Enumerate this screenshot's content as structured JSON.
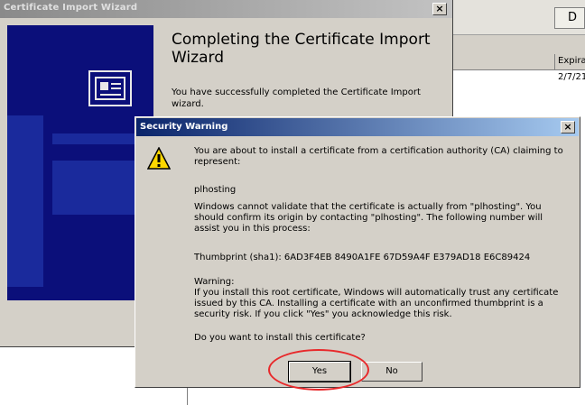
{
  "background_window": {
    "toolbar_glyph": "D",
    "column_header": "Expirat",
    "row_value": "2/7/21"
  },
  "wizard": {
    "title": "Certificate Import Wizard",
    "close_glyph": "×",
    "heading": "Completing the Certificate Import Wizard",
    "body": "You have successfully completed the Certificate Import wizard.",
    "side_icon": "certificate-icon"
  },
  "dialog": {
    "title": "Security Warning",
    "close_glyph": "×",
    "icon": "warning-icon",
    "colors": {
      "warning_fill": "#ffd700",
      "highlight": "#e8292b"
    },
    "intro": "You are about to install a certificate from a certification authority (CA) claiming to represent:",
    "ca_name": "plhosting",
    "validate_text": "Windows cannot validate that the certificate is actually from \"plhosting\". You should confirm its origin by contacting \"plhosting\". The following number will assist you in this process:",
    "thumbprint": "Thumbprint (sha1): 6AD3F4EB 8490A1FE 67D59A4F E379AD18 E6C89424",
    "warning_label": "Warning:",
    "warning_text": "If you install this root certificate, Windows will automatically trust any certificate issued by this CA. Installing a certificate with an unconfirmed thumbprint is a security risk. If you click \"Yes\" you acknowledge this risk.",
    "question": "Do you want to install this certificate?",
    "yes_label": "Yes",
    "no_label": "No"
  }
}
